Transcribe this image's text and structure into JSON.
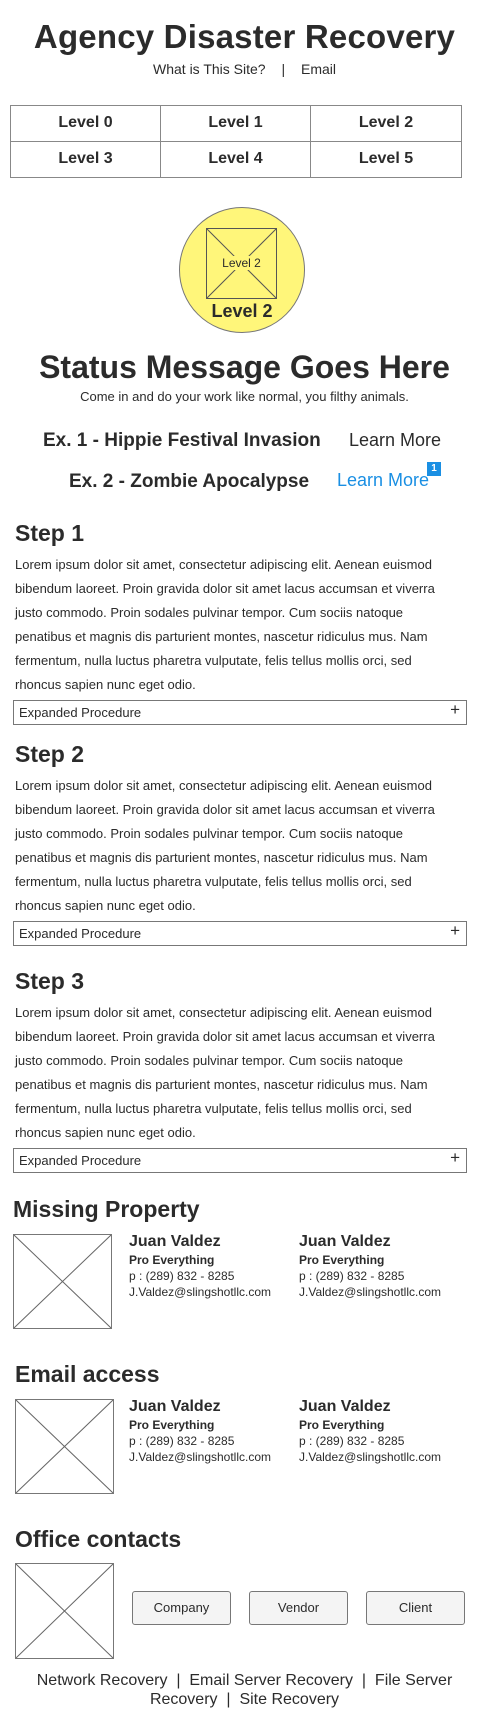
{
  "header": {
    "title": "Agency Disaster Recovery",
    "nav": [
      "What is This Site?",
      "Email"
    ],
    "separator": "|"
  },
  "levels": [
    "Level 0",
    "Level 1",
    "Level 2",
    "Level 3",
    "Level 4",
    "Level 5"
  ],
  "current_level": {
    "image_label": "Level 2",
    "caption": "Level 2",
    "color": "#fff67a"
  },
  "status": {
    "title": "Status Message Goes Here",
    "subtitle": "Come in and do your work like normal, you filthy animals."
  },
  "examples": [
    {
      "title": "Ex. 1 - Hippie Festival Invasion",
      "link": "Learn More"
    },
    {
      "title": "Ex. 2 - Zombie Apocalypse",
      "link": "Learn More",
      "badge": "1"
    }
  ],
  "steps": [
    {
      "title": "Step 1",
      "lines": [
        "Lorem ipsum dolor sit amet, consectetur adipiscing elit. Aenean euismod",
        "bibendum laoreet. Proin gravida dolor sit amet lacus accumsan et viverra",
        "justo commodo. Proin sodales pulvinar tempor. Cum sociis natoque",
        "penatibus et magnis dis parturient montes, nascetur ridiculus mus. Nam",
        "fermentum, nulla luctus pharetra vulputate, felis tellus mollis orci, sed",
        "rhoncus sapien nunc eget odio."
      ],
      "procedure": "Expanded Procedure",
      "toggle": "+"
    },
    {
      "title": "Step 2",
      "lines": [
        "Lorem ipsum dolor sit amet, consectetur adipiscing elit. Aenean euismod",
        "bibendum laoreet. Proin gravida dolor sit amet lacus accumsan et viverra",
        "justo commodo. Proin sodales pulvinar tempor. Cum sociis natoque",
        "penatibus et magnis dis parturient montes, nascetur ridiculus mus. Nam",
        "fermentum, nulla luctus pharetra vulputate, felis tellus mollis orci, sed",
        "rhoncus sapien nunc eget odio."
      ],
      "procedure": "Expanded Procedure",
      "toggle": "+"
    },
    {
      "title": "Step 3",
      "lines": [
        "Lorem ipsum dolor sit amet, consectetur adipiscing elit. Aenean euismod",
        "bibendum laoreet. Proin gravida dolor sit amet lacus accumsan et viverra",
        "justo commodo. Proin sodales pulvinar tempor. Cum sociis natoque",
        "penatibus et magnis dis parturient montes, nascetur ridiculus mus. Nam",
        "fermentum, nulla luctus pharetra vulputate, felis tellus mollis orci, sed",
        "rhoncus sapien nunc eget odio."
      ],
      "procedure": "Expanded Procedure",
      "toggle": "+"
    }
  ],
  "contact_sections": [
    {
      "title": "Missing Property",
      "contacts": [
        {
          "name": "Juan Valdez",
          "role": "Pro Everything",
          "phone": "p : (289) 832 - 8285",
          "email": "J.Valdez@slingshotllc.com"
        },
        {
          "name": "Juan Valdez",
          "role": "Pro Everything",
          "phone": "p : (289) 832 - 8285",
          "email": "J.Valdez@slingshotllc.com"
        }
      ]
    },
    {
      "title": "Email access",
      "contacts": [
        {
          "name": "Juan Valdez",
          "role": "Pro Everything",
          "phone": "p : (289) 832 - 8285",
          "email": "J.Valdez@slingshotllc.com"
        },
        {
          "name": "Juan Valdez",
          "role": "Pro Everything",
          "phone": "p : (289) 832 - 8285",
          "email": "J.Valdez@slingshotllc.com"
        }
      ]
    }
  ],
  "office": {
    "title": "Office contacts",
    "buttons": [
      "Company",
      "Vendor",
      "Client"
    ]
  },
  "footer": {
    "line1": "Network Recovery  |  Email Server Recovery  |  File Server",
    "line2": "Recovery  |  Site Recovery"
  }
}
